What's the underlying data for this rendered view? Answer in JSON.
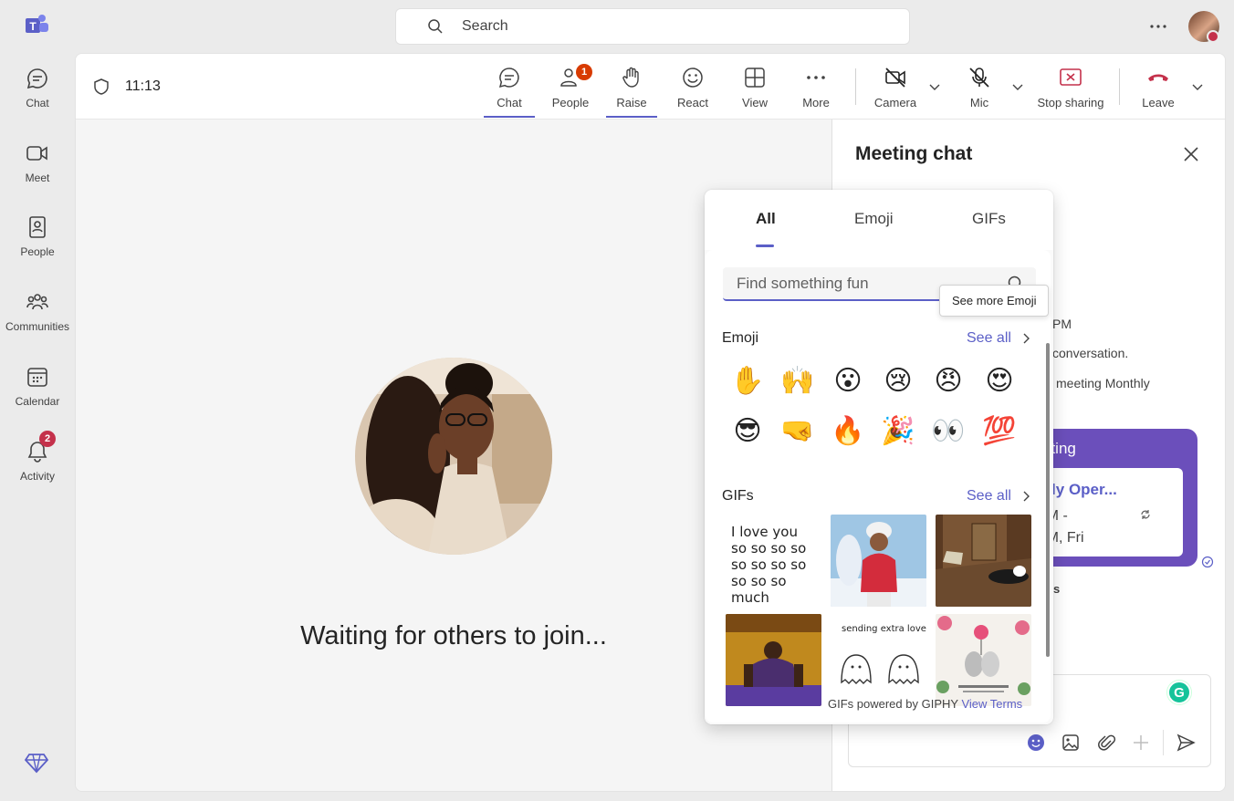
{
  "top": {
    "search_placeholder": "Search",
    "more_label": "···"
  },
  "rail": {
    "items": [
      {
        "label": "Chat",
        "icon": "chat-icon"
      },
      {
        "label": "Meet",
        "icon": "video-icon"
      },
      {
        "label": "People",
        "icon": "contact-book-icon"
      },
      {
        "label": "Communities",
        "icon": "communities-icon"
      },
      {
        "label": "Calendar",
        "icon": "calendar-icon"
      },
      {
        "label": "Activity",
        "icon": "bell-icon",
        "badge": "2"
      }
    ]
  },
  "meeting": {
    "timer": "11:13",
    "toolbar": {
      "chat": "Chat",
      "people": "People",
      "people_badge": "1",
      "raise": "Raise",
      "react": "React",
      "view": "View",
      "more": "More",
      "camera": "Camera",
      "mic": "Mic",
      "stop_sharing": "Stop sharing",
      "leave": "Leave"
    },
    "waiting_text": "Waiting for others to join..."
  },
  "chat": {
    "title": "Meeting chat",
    "messages": [
      "PM",
      "conversation.",
      "meeting Monthly"
    ],
    "card": {
      "header": "eting",
      "title": "thly Oper...",
      "time_line1": "PM -",
      "time_line2": "PM, Fri"
    },
    "fragment": "s"
  },
  "picker": {
    "tabs": [
      "All",
      "Emoji",
      "GIFs"
    ],
    "search_placeholder": "Find something fun",
    "tooltip": "See more Emoji",
    "emoji_title": "Emoji",
    "gifs_title": "GIFs",
    "see_all": "See all",
    "emojis": [
      "✋",
      "🙌",
      "😮",
      "😢",
      "😠",
      "😍",
      "😎",
      "🤜",
      "🔥",
      "🎉",
      "👀",
      "💯"
    ],
    "gif_texts": {
      "love": "I love you so so so so so so so so so so so much",
      "sending": "sending extra love!"
    },
    "footer_text": "GIFs powered by GIPHY",
    "footer_link": "View Terms"
  },
  "colors": {
    "accent": "#5b5fc7",
    "badge": "#c4314b",
    "card": "#6b4fbb",
    "leave": "#c4314b"
  }
}
